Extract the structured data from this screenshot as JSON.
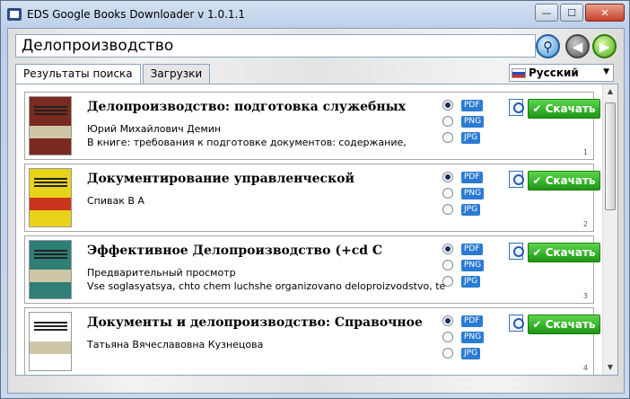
{
  "window": {
    "title": "EDS Google Books Downloader v 1.0.1.1",
    "buttons": {
      "minimize": "—",
      "maximize": "☐",
      "close": "✕"
    }
  },
  "search": {
    "value": "Делопроизводство"
  },
  "tabs": [
    {
      "label": "Результаты поиска"
    },
    {
      "label": "Загрузки"
    }
  ],
  "language": {
    "selected": "Русский"
  },
  "results": [
    {
      "title": "Делопроизводство: подготовка служебных",
      "author": "Юрий Михайлович Демин",
      "description": "В книге: требования к подготовке документов: содержание,",
      "formats": [
        "PDF",
        "PNG",
        "JPG"
      ],
      "download_label": "Скачать",
      "number": "1",
      "cover_color": "#7a2a1e"
    },
    {
      "title": "Документирование управленческой",
      "author": "Спивак В А",
      "description": "",
      "formats": [
        "PDF",
        "PNG",
        "JPG"
      ],
      "download_label": "Скачать",
      "number": "2",
      "cover_color": "#e9d21a"
    },
    {
      "title": "Эффективное Делопроизводство (+cd С",
      "author": "Предварительный просмотр",
      "description": "Vse soglasyatsya, chto chem luchshe organizovano deloproizvodstvo, tem",
      "formats": [
        "PDF",
        "PNG",
        "JPG"
      ],
      "download_label": "Скачать",
      "number": "3",
      "cover_color": "#2f7f76"
    },
    {
      "title": "Документы и делопроизводство: Справочное",
      "author": "Татьяна Вячеславовна Кузнецова",
      "description": "",
      "formats": [
        "PDF",
        "PNG",
        "JPG"
      ],
      "download_label": "Скачать",
      "number": "4",
      "cover_color": "#ffffff"
    }
  ],
  "icons": {
    "search": "magnifier-icon",
    "back": "arrow-left-icon",
    "forward": "arrow-right-icon",
    "preview": "magnifier-page-icon",
    "download": "checkmark-icon"
  }
}
